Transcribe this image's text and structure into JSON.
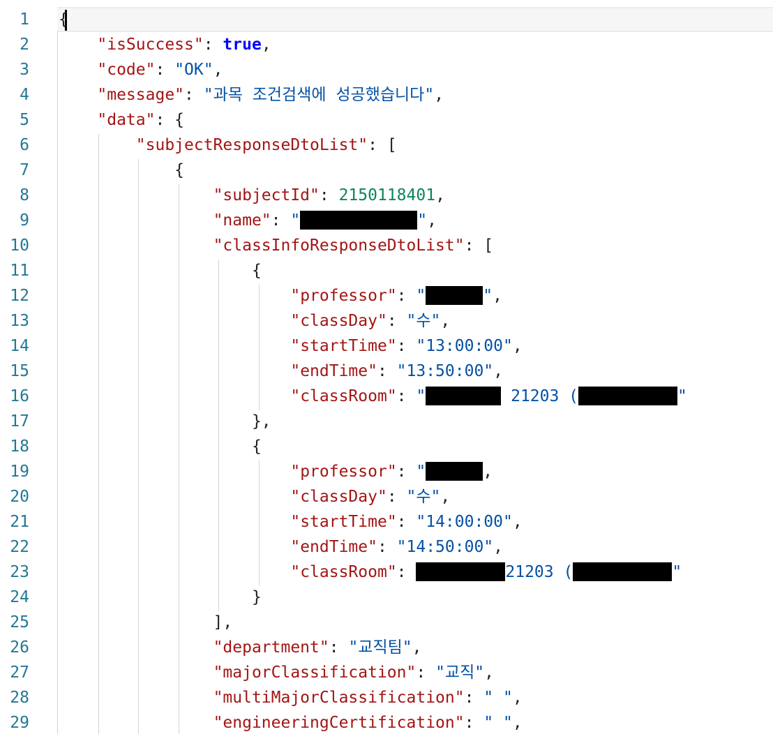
{
  "editor": {
    "line_numbers": [
      "1",
      "2",
      "3",
      "4",
      "5",
      "6",
      "7",
      "8",
      "9",
      "10",
      "11",
      "12",
      "13",
      "14",
      "15",
      "16",
      "17",
      "18",
      "19",
      "20",
      "21",
      "22",
      "23",
      "24",
      "25",
      "26",
      "27",
      "28",
      "29"
    ]
  },
  "json": {
    "open_brace": "{",
    "isSuccess_key": "\"isSuccess\"",
    "isSuccess_val": "true",
    "code_key": "\"code\"",
    "code_val": "\"OK\"",
    "message_key": "\"message\"",
    "message_val": "\"과목 조건검색에 성공했습니다\"",
    "data_key": "\"data\"",
    "list_key": "\"subjectResponseDtoList\"",
    "subjectId_key": "\"subjectId\"",
    "subjectId_val": "2150118401",
    "name_key": "\"name\"",
    "classInfo_key": "\"classInfoResponseDtoList\"",
    "professor_key": "\"professor\"",
    "classDay_key": "\"classDay\"",
    "classDay_val": "\"수\"",
    "startTime_key": "\"startTime\"",
    "startTime_val_1": "\"13:00:00\"",
    "startTime_val_2": "\"14:00:00\"",
    "endTime_key": "\"endTime\"",
    "endTime_val_1": "\"13:50:00\"",
    "endTime_val_2": "\"14:50:00\"",
    "classRoom_key": "\"classRoom\"",
    "classRoom_num": "21203 (",
    "department_key": "\"department\"",
    "department_val": "\"교직팀\"",
    "major_key": "\"majorClassification\"",
    "major_val": "\"교직\"",
    "multiMajor_key": "\"multiMajorClassification\"",
    "multiMajor_val": "\" \"",
    "engCert_key": "\"engineeringCertification\"",
    "engCert_val": "\" \""
  }
}
